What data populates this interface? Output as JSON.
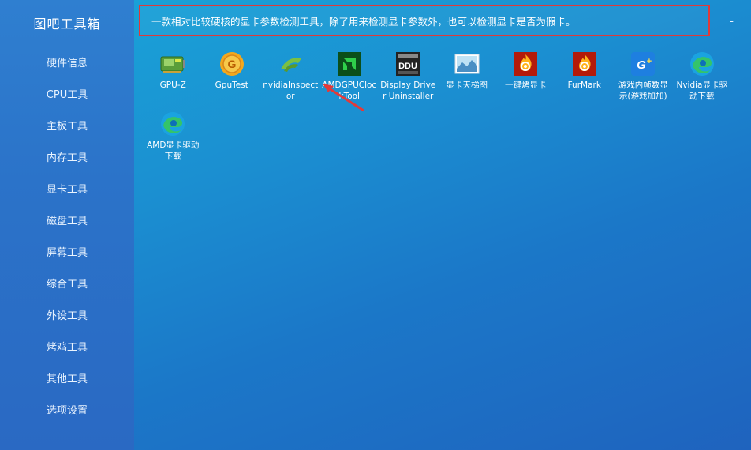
{
  "app": {
    "title": "图吧工具箱",
    "minimize_symbol": "-"
  },
  "sidebar": {
    "items": [
      {
        "label": "硬件信息"
      },
      {
        "label": "CPU工具"
      },
      {
        "label": "主板工具"
      },
      {
        "label": "内存工具"
      },
      {
        "label": "显卡工具"
      },
      {
        "label": "磁盘工具"
      },
      {
        "label": "屏幕工具"
      },
      {
        "label": "综合工具"
      },
      {
        "label": "外设工具"
      },
      {
        "label": "烤鸡工具"
      },
      {
        "label": "其他工具"
      },
      {
        "label": "选项设置"
      }
    ]
  },
  "description": "一款相对比较硬核的显卡参数检测工具，除了用来检测显卡参数外，也可以检测显卡是否为假卡。",
  "tools": [
    {
      "label": "GPU-Z",
      "icon": "gpu-z-card-icon"
    },
    {
      "label": "GpuTest",
      "icon": "gear-sun-icon"
    },
    {
      "label": "nvidiaInspector",
      "icon": "nvidia-claw-icon"
    },
    {
      "label": "AMDGPUClockTool",
      "icon": "amd-logo-icon"
    },
    {
      "label": "Display Driver Uninstaller",
      "icon": "ddu-icon"
    },
    {
      "label": "显卡天梯图",
      "icon": "ladder-chart-icon"
    },
    {
      "label": "一键烤显卡",
      "icon": "furmark-flame-icon"
    },
    {
      "label": "FurMark",
      "icon": "furmark-flame-icon"
    },
    {
      "label": "游戏内帧数显示(游戏加加)",
      "icon": "game-plus-icon"
    },
    {
      "label": "Nvidia显卡驱动下载",
      "icon": "edge-browser-icon"
    },
    {
      "label": "AMD显卡驱动下载",
      "icon": "edge-browser-icon"
    }
  ],
  "colors": {
    "highlight_border": "#e03a3a",
    "annotation_arrow": "#e23a3a"
  }
}
